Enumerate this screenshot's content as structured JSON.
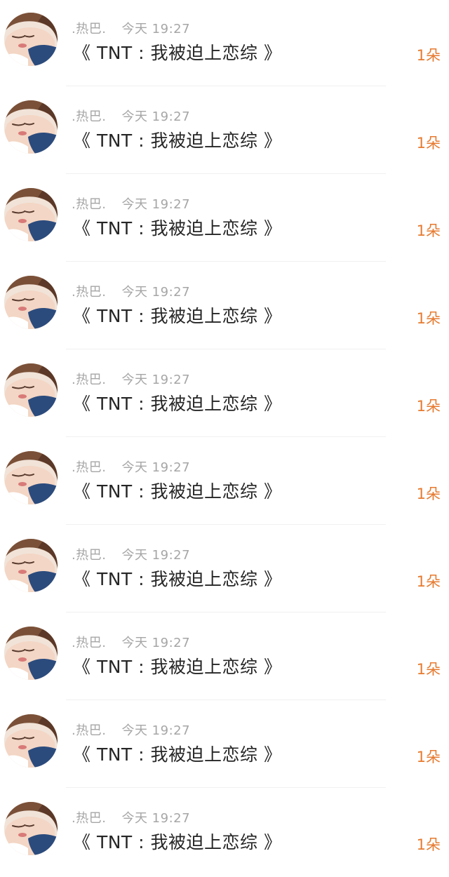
{
  "messages": [
    {
      "user": ".热巴.",
      "time": "今天 19:27",
      "title": "《 TNT : 我被迫上恋综 》",
      "count": "1朵",
      "avatar_icon": "user-avatar-sleeping-girl"
    },
    {
      "user": ".热巴.",
      "time": "今天 19:27",
      "title": "《 TNT : 我被迫上恋综 》",
      "count": "1朵",
      "avatar_icon": "user-avatar-sleeping-girl"
    },
    {
      "user": ".热巴.",
      "time": "今天 19:27",
      "title": "《 TNT : 我被迫上恋综 》",
      "count": "1朵",
      "avatar_icon": "user-avatar-sleeping-girl"
    },
    {
      "user": ".热巴.",
      "time": "今天 19:27",
      "title": "《 TNT : 我被迫上恋综 》",
      "count": "1朵",
      "avatar_icon": "user-avatar-sleeping-girl"
    },
    {
      "user": ".热巴.",
      "time": "今天 19:27",
      "title": "《 TNT : 我被迫上恋综 》",
      "count": "1朵",
      "avatar_icon": "user-avatar-sleeping-girl"
    },
    {
      "user": ".热巴.",
      "time": "今天 19:27",
      "title": "《 TNT : 我被迫上恋综 》",
      "count": "1朵",
      "avatar_icon": "user-avatar-sleeping-girl"
    },
    {
      "user": ".热巴.",
      "time": "今天 19:27",
      "title": "《 TNT : 我被迫上恋综 》",
      "count": "1朵",
      "avatar_icon": "user-avatar-sleeping-girl"
    },
    {
      "user": ".热巴.",
      "time": "今天 19:27",
      "title": "《 TNT : 我被迫上恋综 》",
      "count": "1朵",
      "avatar_icon": "user-avatar-sleeping-girl"
    },
    {
      "user": ".热巴.",
      "time": "今天 19:27",
      "title": "《 TNT : 我被迫上恋综 》",
      "count": "1朵",
      "avatar_icon": "user-avatar-sleeping-girl"
    },
    {
      "user": ".热巴.",
      "time": "今天 19:27",
      "title": "《 TNT : 我被迫上恋综 》",
      "count": "1朵",
      "avatar_icon": "user-avatar-sleeping-girl"
    }
  ],
  "colors": {
    "meta_text": "#a6a6a6",
    "title_text": "#262626",
    "count_text": "#e67a2f",
    "divider": "#f0f0f0"
  }
}
